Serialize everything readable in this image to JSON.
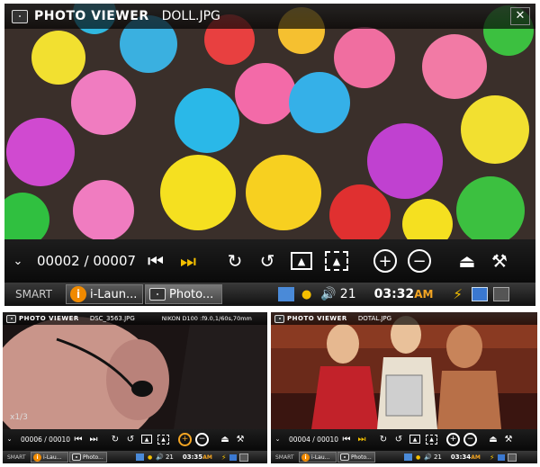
{
  "viewers": [
    {
      "app_title": "PHOTO VIEWER",
      "file_name": "DOLL.JPG",
      "exif": "",
      "counter_current": "00002",
      "counter_total": "00007",
      "counter_sep": "/",
      "overlay": "",
      "taskbar": {
        "smart": "SMART",
        "app1": "i-Laun...",
        "app2": "Photo...",
        "volume": "21",
        "time": "03:32",
        "ampm": "AM"
      }
    },
    {
      "app_title": "PHOTO VIEWER",
      "file_name": "DSC_3563.JPG",
      "exif": "NIKON D100 :f9.0,1/60s,70mm",
      "counter_current": "00006",
      "counter_total": "00010",
      "counter_sep": "/",
      "overlay": "x1/3",
      "taskbar": {
        "smart": "SMART",
        "app1": "i-Lau...",
        "app2": "Photo...",
        "volume": "21",
        "time": "03:35",
        "ampm": "AM"
      }
    },
    {
      "app_title": "PHOTO VIEWER",
      "file_name": "DOTAL.JPG",
      "exif": "",
      "counter_current": "00004",
      "counter_total": "00010",
      "counter_sep": "/",
      "overlay": "",
      "taskbar": {
        "smart": "SMART",
        "app1": "i-Lau...",
        "app2": "Photo...",
        "volume": "21",
        "time": "03:34",
        "ampm": "AM"
      }
    }
  ],
  "close_glyph": "✕",
  "icons": {
    "menu": "chevron-down-icon",
    "prev": "skip-previous-icon",
    "next": "skip-next-icon",
    "rotate_cw": "rotate-clockwise-icon",
    "rotate_ccw": "rotate-counterclockwise-icon",
    "wallpaper": "wallpaper-icon",
    "fit": "fit-screen-icon",
    "zoom_in": "zoom-in-icon",
    "zoom_out": "zoom-out-icon",
    "eject": "eject-icon",
    "tools": "hammer-icon"
  },
  "colors": {
    "accent_orange": "#f08a00",
    "next_button": "#f5c000",
    "ampm": "#f5a623"
  }
}
